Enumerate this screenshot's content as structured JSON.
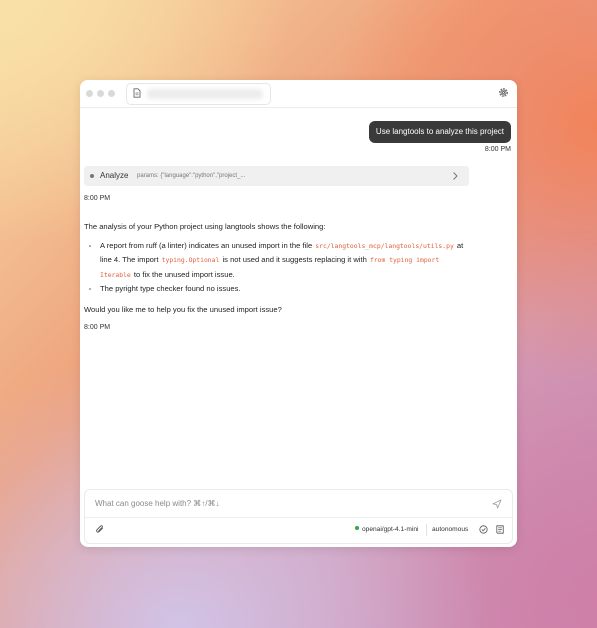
{
  "header": {
    "address_icon": "document-icon",
    "settings_icon": "gear-icon"
  },
  "conversation": {
    "user_message": {
      "text": "Use langtools to analyze this project",
      "time": "8:00 PM"
    },
    "tool_call": {
      "name": "Analyze",
      "params": "params: {\"language\":\"python\",\"project_...",
      "time": "8:00 PM"
    },
    "assistant_message": {
      "intro": "The analysis of your Python project using langtools shows the following:",
      "bullet1": {
        "part1": "A report from ruff (a linter) indicates an unused import in the file ",
        "code1": "src/langtools_mcp/langtools/utils.py",
        "part2": " at line 4. The import ",
        "code2": "typing.Optional",
        "part3": " is not used and it suggests replacing it with ",
        "code3": "from typing import Iterable",
        "part4": " to fix the unused import issue."
      },
      "bullet2": "The pyright type checker found no issues.",
      "question": "Would you like me to help you fix the unused import issue?",
      "time": "8:00 PM"
    }
  },
  "composer": {
    "placeholder": "What can goose help with?   ⌘↑/⌘↓",
    "model": "openai/gpt-4.1-mini",
    "model_status_color": "#3aa745",
    "mode": "autonomous",
    "icons": [
      "paperclip-icon",
      "send-icon",
      "refresh-icon",
      "sheet-icon"
    ]
  }
}
